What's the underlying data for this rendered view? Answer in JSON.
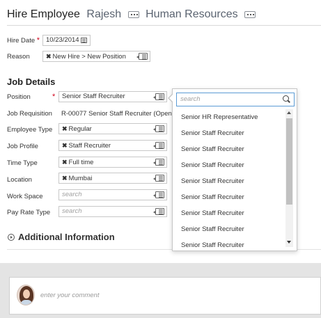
{
  "header": {
    "title": "Hire Employee",
    "employee_name": "Rajesh",
    "organization": "Human Resources"
  },
  "fields": {
    "hire_date": {
      "label": "Hire Date",
      "required_mark": "*",
      "value": "10/23/2014"
    },
    "reason": {
      "label": "Reason",
      "remove_glyph": "✖",
      "value": "New Hire > New Position"
    }
  },
  "job_details": {
    "heading": "Job Details",
    "position": {
      "label": "Position",
      "required_mark": "*",
      "value": "Senior Staff Recruiter"
    },
    "job_requisition": {
      "label": "Job Requisition",
      "value": "R-00077 Senior Staff Recruiter (Open)"
    },
    "employee_type": {
      "label": "Employee Type",
      "remove_glyph": "✖",
      "value": "Regular"
    },
    "job_profile": {
      "label": "Job Profile",
      "remove_glyph": "✖",
      "value": "Staff Recruiter"
    },
    "time_type": {
      "label": "Time Type",
      "remove_glyph": "✖",
      "value": "Full time"
    },
    "location": {
      "label": "Location",
      "remove_glyph": "✖",
      "value": "Mumbai"
    },
    "work_space": {
      "label": "Work Space",
      "placeholder": "search"
    },
    "pay_rate_type": {
      "label": "Pay Rate Type",
      "placeholder": "search"
    }
  },
  "additional_information": {
    "heading": "Additional Information"
  },
  "popup": {
    "search_placeholder": "search",
    "items": [
      "Senior HR Representative",
      "Senior Staff Recruiter",
      "Senior Staff Recruiter",
      "Senior Staff Recruiter",
      "Senior Staff Recruiter",
      "Senior Staff Recruiter",
      "Senior Staff Recruiter",
      "Senior Staff Recruiter",
      "Senior Staff Recruiter"
    ]
  },
  "comment": {
    "placeholder": "enter your comment"
  },
  "icons": {
    "more": "more-options-icon",
    "calendar": "calendar-icon",
    "prompt": "prompt-list-icon",
    "search": "search-icon",
    "expand": "expand-circle-icon"
  },
  "colors": {
    "required": "#d0021b",
    "focus_border": "#5b9bd5",
    "comment_band": "#e4e4e4"
  }
}
